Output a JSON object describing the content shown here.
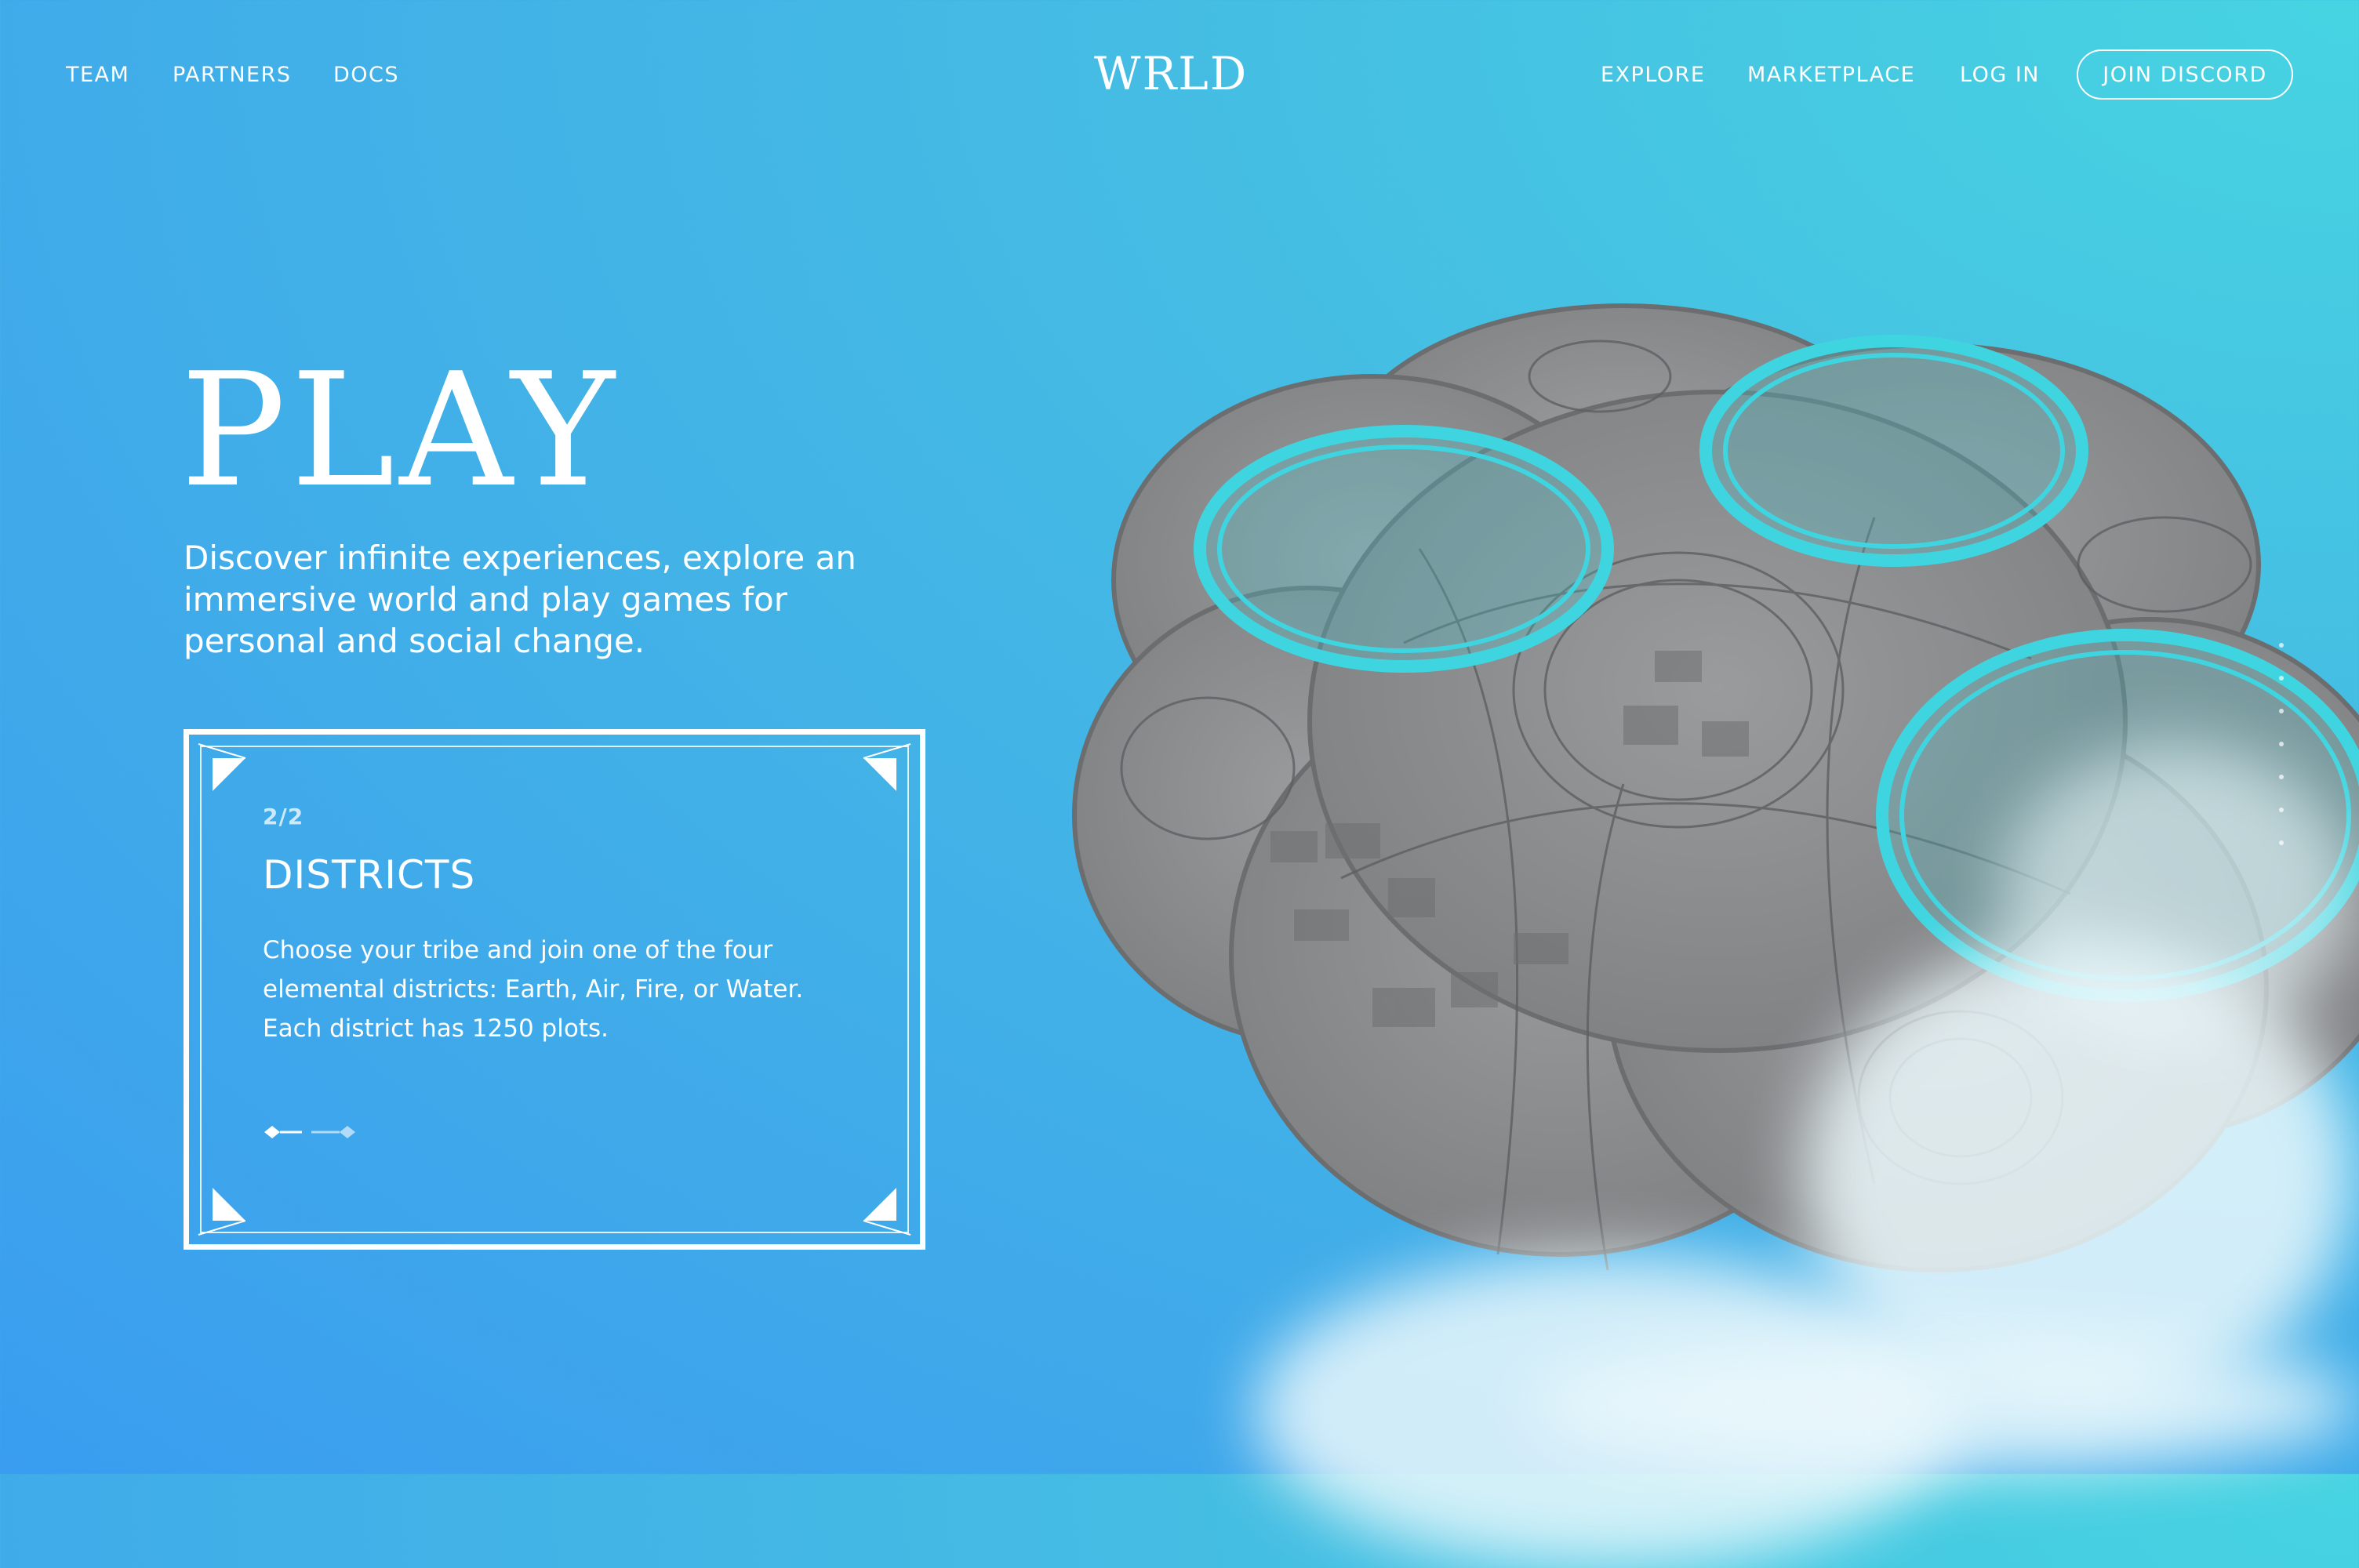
{
  "nav": {
    "left": [
      "TEAM",
      "PARTNERS",
      "DOCS"
    ],
    "logo": "WRLD",
    "right": [
      "EXPLORE",
      "MARKETPLACE",
      "LOG IN"
    ],
    "discord_label": "JOIN DISCORD"
  },
  "hero": {
    "title": "PLAY",
    "subtitle": "Discover infinite experiences, explore an immersive world and play games for personal and social change."
  },
  "card": {
    "counter": "2/2",
    "title": "DISTRICTS",
    "body": "Choose your tribe and join one of the four elemental districts:  Earth, Air, Fire, or Water. Each district has 1250 plots."
  },
  "colors": {
    "accent_ring": "#3fd5e0",
    "map_gray": "#8e8f91",
    "background_start": "#3a9df0",
    "background_end": "#46d4e2"
  },
  "icons": [
    "diamond-pager-icon",
    "dot-scroll-indicator"
  ]
}
